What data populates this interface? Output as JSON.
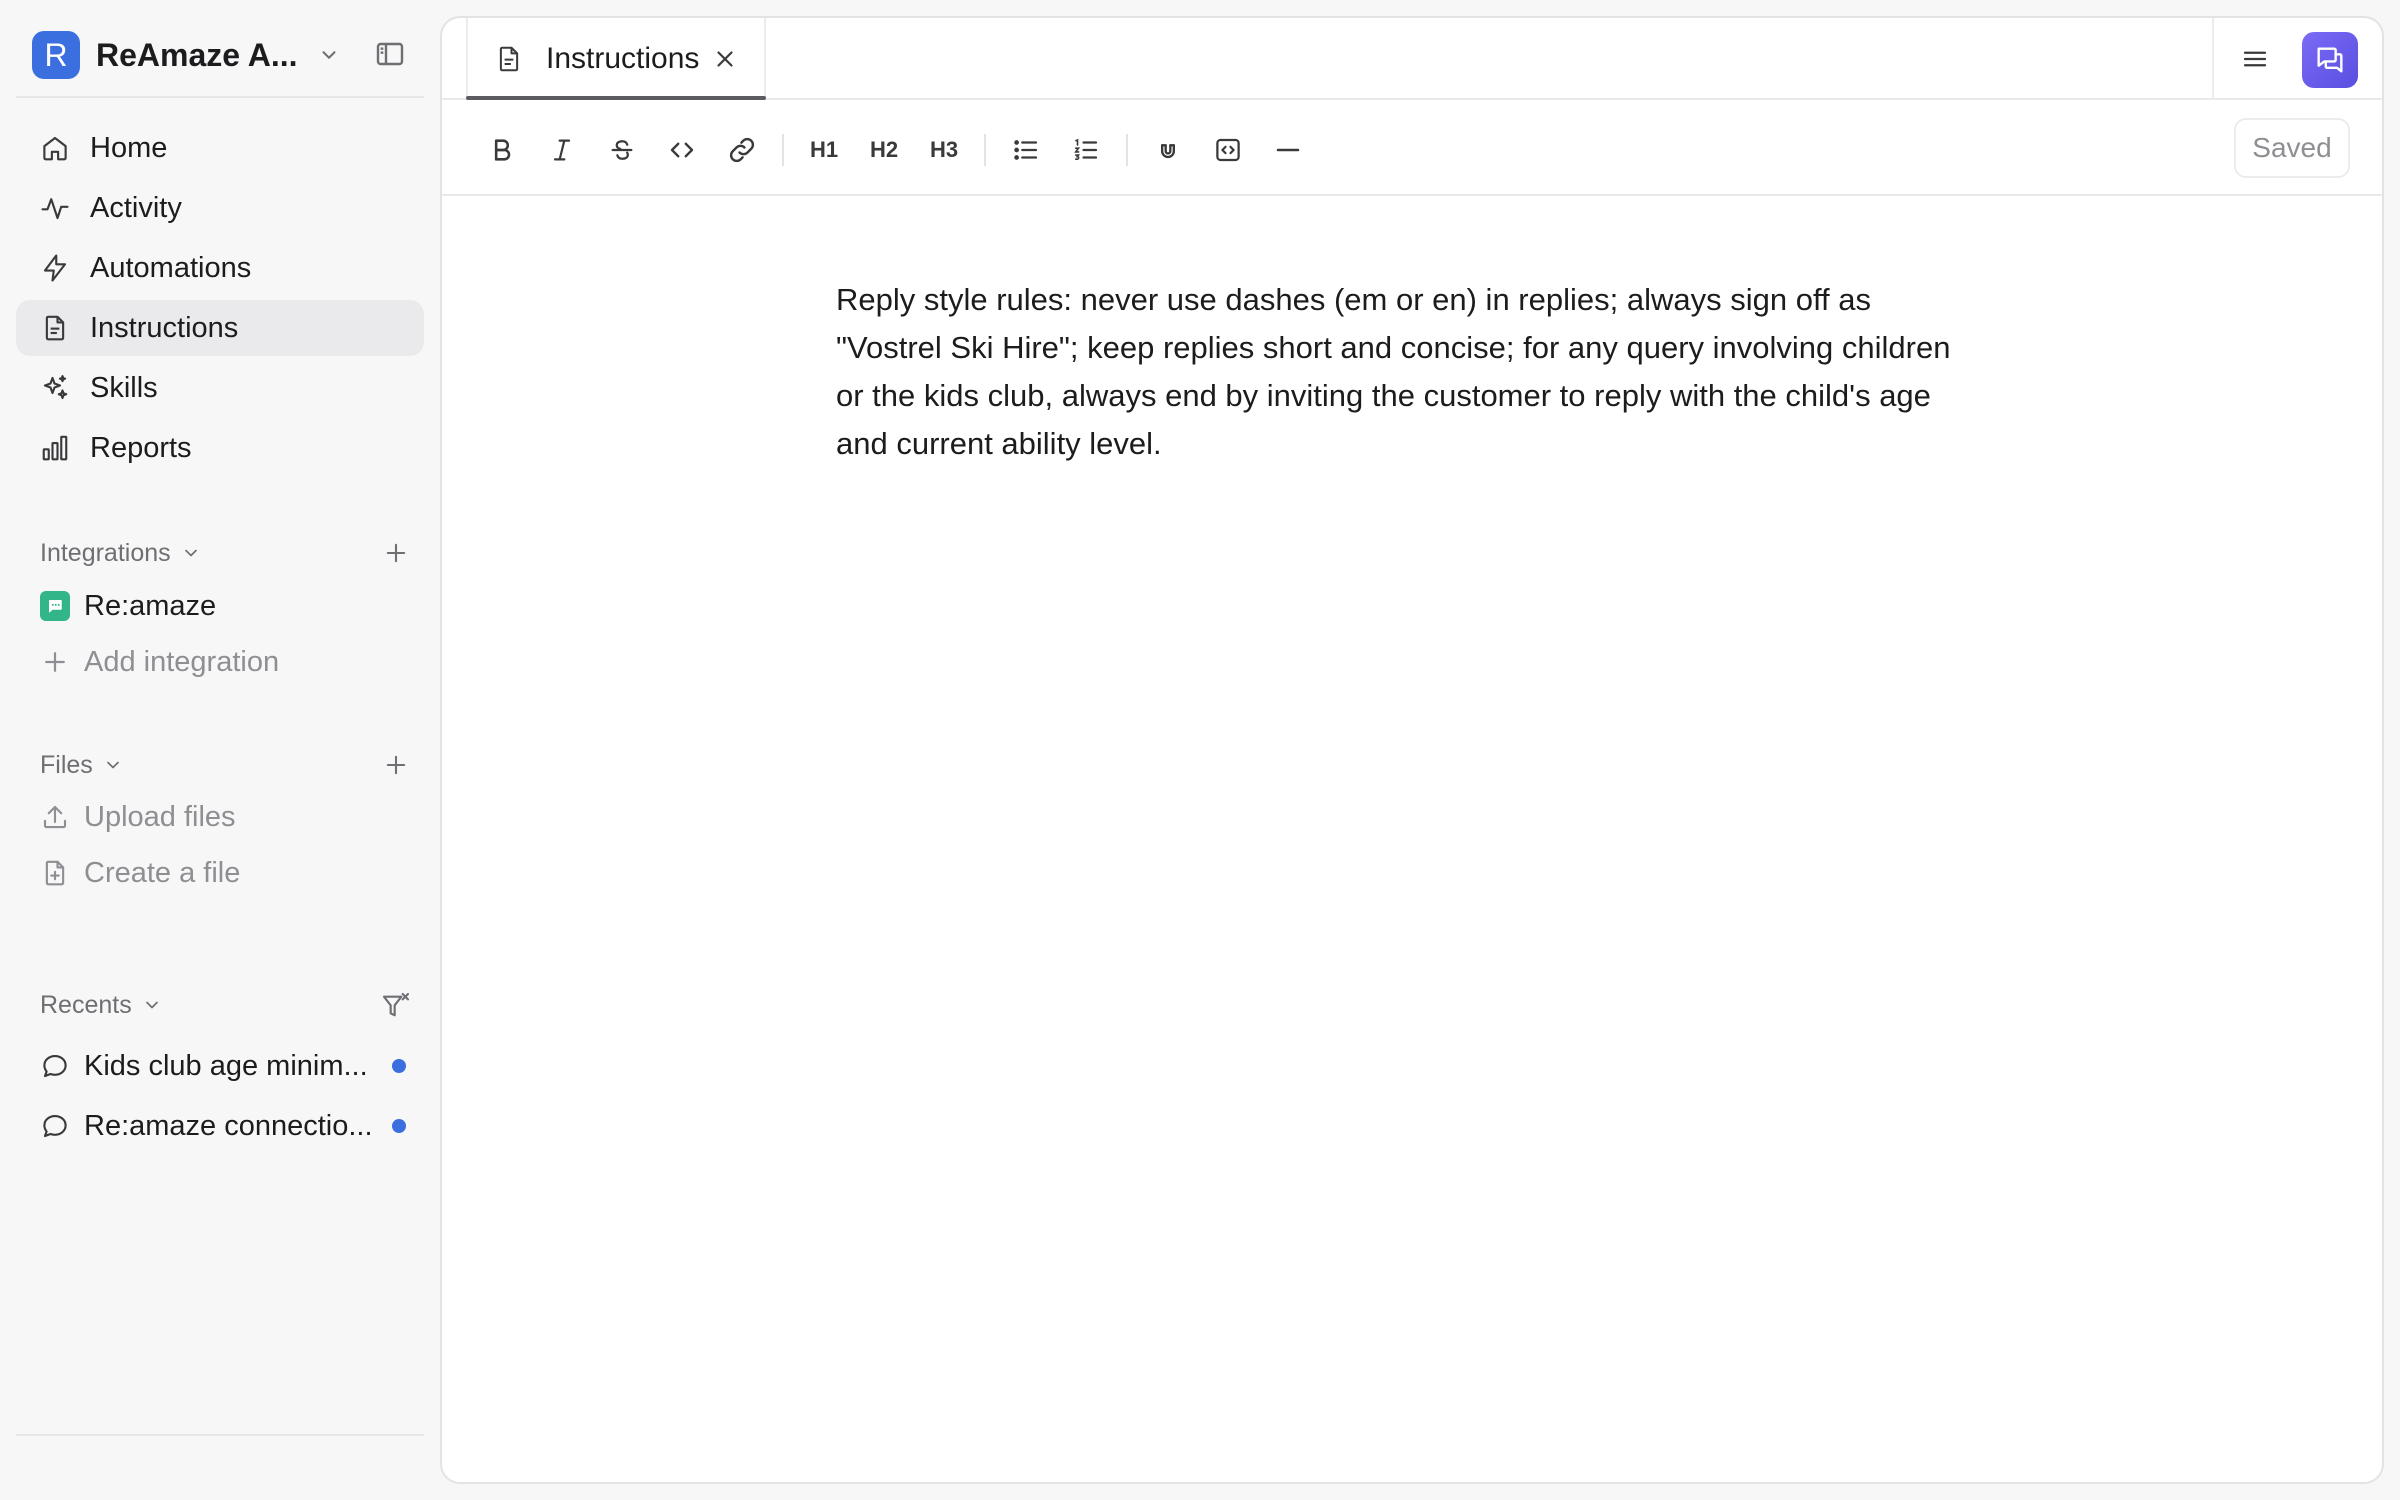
{
  "workspace": {
    "initial": "R",
    "name": "ReAmaze A..."
  },
  "nav": {
    "items": [
      {
        "label": "Home",
        "icon": "home-icon"
      },
      {
        "label": "Activity",
        "icon": "activity-icon"
      },
      {
        "label": "Automations",
        "icon": "lightning-icon"
      },
      {
        "label": "Instructions",
        "icon": "document-icon",
        "active": true
      },
      {
        "label": "Skills",
        "icon": "sparkles-icon"
      },
      {
        "label": "Reports",
        "icon": "bar-chart-icon"
      }
    ]
  },
  "integrations": {
    "title": "Integrations",
    "items": [
      {
        "label": "Re:amaze"
      }
    ],
    "add_label": "Add integration"
  },
  "files": {
    "title": "Files",
    "upload_label": "Upload files",
    "create_label": "Create a file"
  },
  "recents": {
    "title": "Recents",
    "items": [
      {
        "label": "Kids club age minim...",
        "unread": true
      },
      {
        "label": "Re:amaze connectio...",
        "unread": true
      }
    ]
  },
  "tab": {
    "label": "Instructions"
  },
  "toolbar": {
    "h1": "H1",
    "h2": "H2",
    "h3": "H3",
    "status": "Saved"
  },
  "editor": {
    "content": "Reply style rules: never use dashes (em or en) in replies; always sign off as \"Vostrel Ski Hire\"; keep replies short and concise; for any query involving children or the kids club, always end by inviting the customer to reply with the child's age and current ability level."
  },
  "colors": {
    "accent": "#3b6fe0",
    "active_nav_bg": "#eaeaec",
    "reamaze_green": "#33b58a",
    "chat_button": "#6a5cf0"
  }
}
